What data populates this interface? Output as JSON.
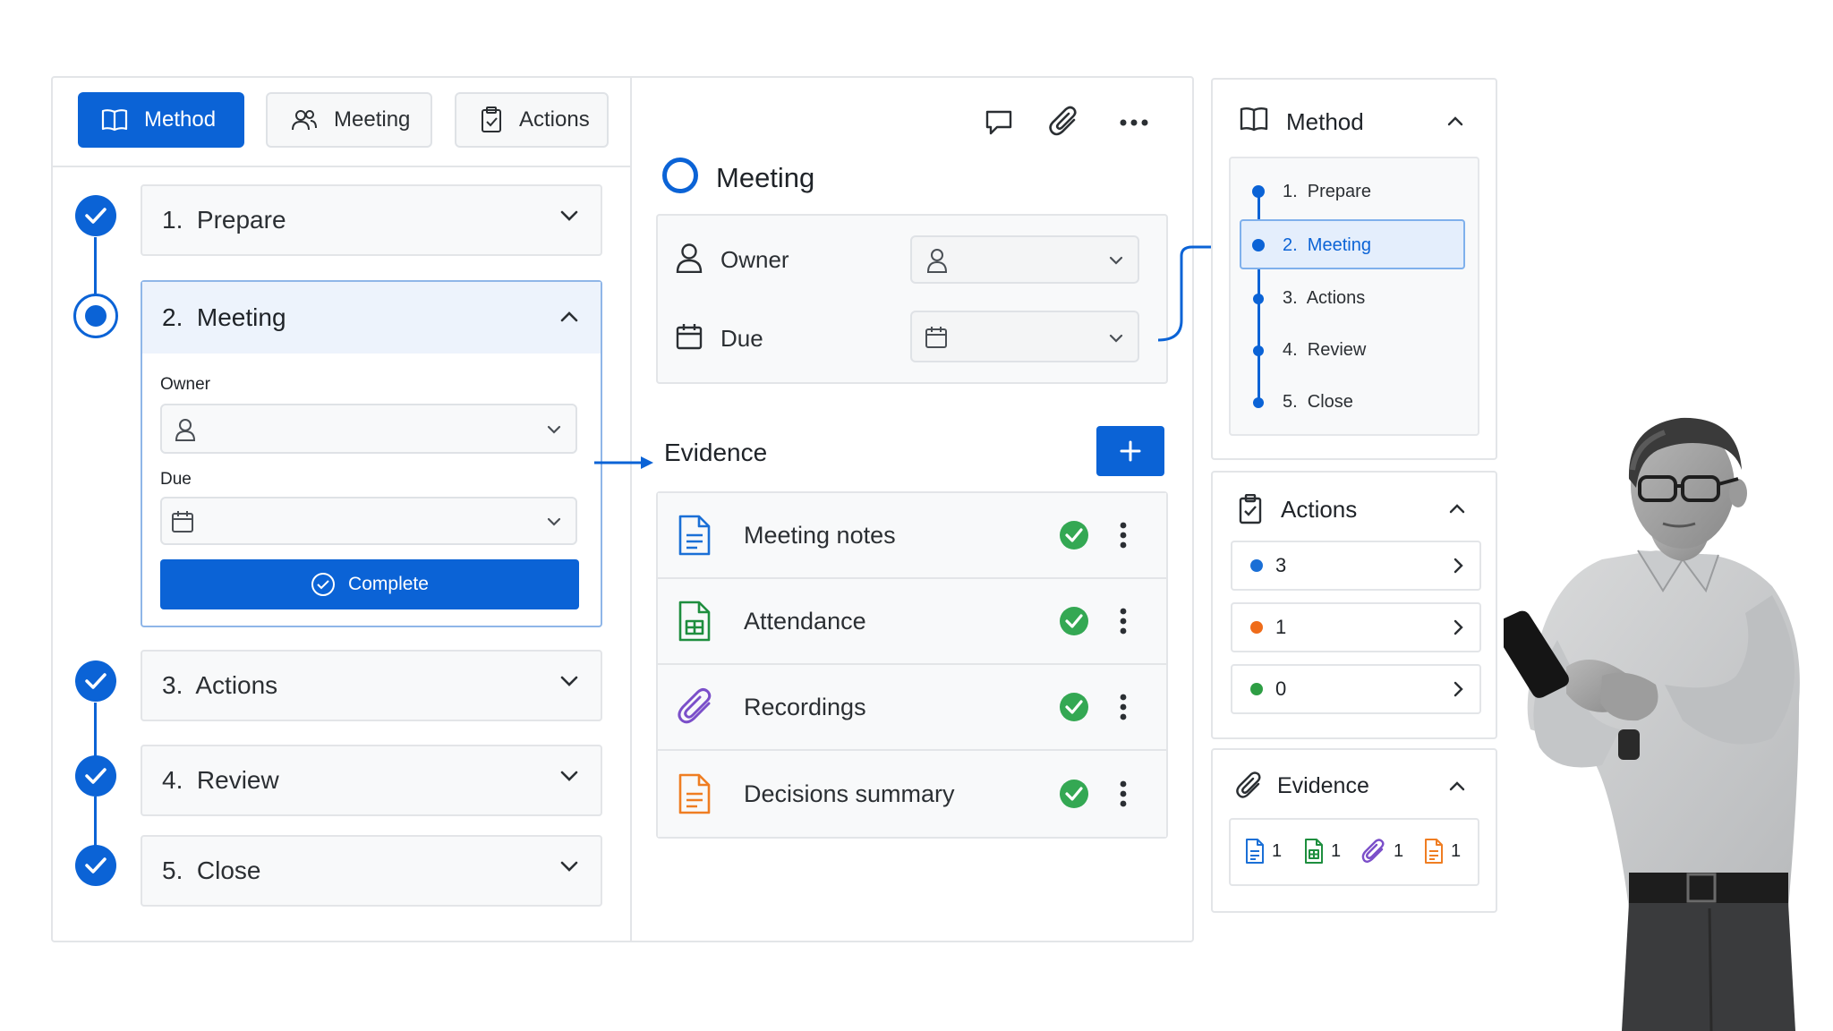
{
  "tabs": [
    {
      "label": "Method",
      "icon": "book-icon",
      "active": true
    },
    {
      "label": "Meeting",
      "icon": "users-icon",
      "active": false
    },
    {
      "label": "Actions",
      "icon": "clipboard-check-icon",
      "active": false
    }
  ],
  "steps": [
    {
      "label": "1.  Prepare",
      "done": true
    },
    {
      "label": "2.  Meeting",
      "current": true
    },
    {
      "label": "3.  Actions",
      "done": true
    },
    {
      "label": "4.  Review",
      "done": true
    },
    {
      "label": "5.  Close",
      "done": true
    }
  ],
  "meeting_form": {
    "owner_label": "Owner",
    "due_label": "Due",
    "complete_label": "Complete"
  },
  "detail": {
    "title": "Meeting",
    "owner_label": "Owner",
    "due_label": "Due",
    "evidence_label": "Evidence",
    "evidence": [
      {
        "label": "Meeting notes",
        "icon": "document-icon",
        "color": "#1a6fd6",
        "status": "complete"
      },
      {
        "label": "Attendance",
        "icon": "spreadsheet-icon",
        "color": "#1e8e3e",
        "status": "complete"
      },
      {
        "label": "Recordings",
        "icon": "paperclip-icon",
        "color": "#7b4fc9",
        "status": "complete"
      },
      {
        "label": "Decisions summary",
        "icon": "document-icon",
        "color": "#ef7d22",
        "status": "complete"
      }
    ]
  },
  "right": {
    "method": {
      "title": "Method",
      "items": [
        "1.  Prepare",
        "2.  Meeting",
        "3.  Actions",
        "4.  Review",
        "5.  Close"
      ],
      "active_index": 1
    },
    "actions": {
      "title": "Actions",
      "rows": [
        {
          "count": "3",
          "color": "#1a6fd6"
        },
        {
          "count": "1",
          "color": "#ef6c1a"
        },
        {
          "count": "0",
          "color": "#2e9e44"
        }
      ]
    },
    "evidence": {
      "title": "Evidence",
      "counts": [
        {
          "icon": "document-icon",
          "color": "#1a6fd6",
          "count": "1"
        },
        {
          "icon": "spreadsheet-icon",
          "color": "#1e8e3e",
          "count": "1"
        },
        {
          "icon": "paperclip-icon",
          "color": "#7b4fc9",
          "count": "1"
        },
        {
          "icon": "document-icon",
          "color": "#ef7d22",
          "count": "1"
        }
      ]
    }
  },
  "colors": {
    "accent": "#0b63d6",
    "success": "#34a853"
  }
}
